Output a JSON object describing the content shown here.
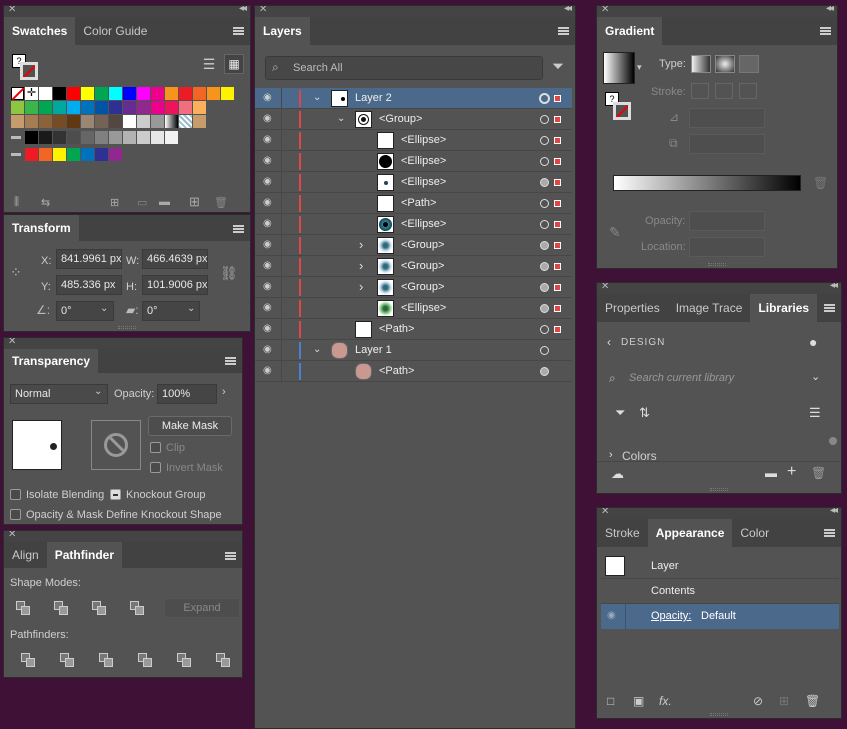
{
  "swatches": {
    "tabs": [
      "Swatches",
      "Color Guide"
    ],
    "colors_row1": [
      "#ffffff",
      "#000000",
      "#ff0000",
      "#ffff00",
      "#00a651",
      "#00ffff",
      "#0000ff",
      "#ff00ff",
      "#ec008c",
      "#f7941d",
      "#ed1c24",
      "#f26522",
      "#f7941d",
      "#fff200"
    ],
    "colors_row2": [
      "#8dc63f",
      "#39b54a",
      "#00a651",
      "#00a99d",
      "#00aeef",
      "#0072bc",
      "#0054a6",
      "#2e3192",
      "#662d91",
      "#92278f",
      "#ec008c",
      "#ed145b",
      "#f26d7d",
      "#fbaf5d"
    ],
    "colors_row3": [
      "#c69c6d",
      "#a67c52",
      "#8c6239",
      "#754c24",
      "#603913",
      "#998675",
      "#736357",
      "#534741",
      "#ffffff",
      "#cccccc",
      "#999999",
      "#f7941d",
      "#7da7d9",
      "#c69c6d"
    ],
    "grays": [
      "#000000",
      "#1a1a1a",
      "#333333",
      "#4d4d4d",
      "#666666",
      "#808080",
      "#999999",
      "#b3b3b3",
      "#cccccc",
      "#e6e6e6",
      "#f2f2f2"
    ],
    "brights": [
      "#ed1c24",
      "#f26522",
      "#fff200",
      "#00a651",
      "#0072bc",
      "#2e3192",
      "#92278f"
    ]
  },
  "transform": {
    "title": "Transform",
    "x_label": "X:",
    "x_value": "841.9961 px",
    "y_label": "Y:",
    "y_value": "485.336 px",
    "w_label": "W:",
    "w_value": "466.4639 px",
    "h_label": "H:",
    "h_value": "101.9006 px",
    "angle_value": "0°",
    "shear_value": "0°"
  },
  "transparency": {
    "title": "Transparency",
    "blend_mode": "Normal",
    "opacity_label": "Opacity:",
    "opacity_value": "100%",
    "make_mask": "Make Mask",
    "clip": "Clip",
    "invert_mask": "Invert Mask",
    "isolate_blending": "Isolate Blending",
    "knockout_group": "Knockout Group",
    "opacity_mask_define": "Opacity & Mask Define Knockout Shape"
  },
  "pathfinder": {
    "tabs": [
      "Align",
      "Pathfinder"
    ],
    "shape_modes": "Shape Modes:",
    "expand": "Expand",
    "pathfinders": "Pathfinders:"
  },
  "layers": {
    "title": "Layers",
    "search_placeholder": "Search All",
    "rows": [
      {
        "name": "Layer 2",
        "indent": 0,
        "chevron": "expanded",
        "thumb": "dot",
        "color": "#e04646",
        "selected": true
      },
      {
        "name": "<Group>",
        "indent": 1,
        "chevron": "expanded",
        "thumb": "target",
        "color": "#e04646",
        "selected": false
      },
      {
        "name": "<Ellipse>",
        "indent": 2,
        "chevron": "",
        "thumb": "white",
        "color": "#e04646",
        "selected": false
      },
      {
        "name": "<Ellipse>",
        "indent": 2,
        "chevron": "",
        "thumb": "black",
        "color": "#e04646",
        "selected": false
      },
      {
        "name": "<Ellipse>",
        "indent": 2,
        "chevron": "",
        "thumb": "tiny",
        "color": "#e04646",
        "selected": false
      },
      {
        "name": "<Path>",
        "indent": 2,
        "chevron": "",
        "thumb": "white",
        "color": "#e04646",
        "selected": false
      },
      {
        "name": "<Ellipse>",
        "indent": 2,
        "chevron": "",
        "thumb": "eye",
        "color": "#e04646",
        "selected": false
      },
      {
        "name": "<Group>",
        "indent": 2,
        "chevron": "collapsed",
        "thumb": "pattern",
        "color": "#e04646",
        "selected": false
      },
      {
        "name": "<Group>",
        "indent": 2,
        "chevron": "collapsed",
        "thumb": "pattern",
        "color": "#e04646",
        "selected": false
      },
      {
        "name": "<Group>",
        "indent": 2,
        "chevron": "collapsed",
        "thumb": "pattern",
        "color": "#e04646",
        "selected": false
      },
      {
        "name": "<Ellipse>",
        "indent": 2,
        "chevron": "",
        "thumb": "green",
        "color": "#e04646",
        "selected": false
      },
      {
        "name": "<Path>",
        "indent": 1,
        "chevron": "",
        "thumb": "white",
        "color": "#e04646",
        "selected": false
      },
      {
        "name": "Layer 1",
        "indent": 0,
        "chevron": "expanded",
        "thumb": "pink",
        "color": "#4a7fd4",
        "selected": false
      },
      {
        "name": "<Path>",
        "indent": 1,
        "chevron": "",
        "thumb": "pink",
        "color": "#4a7fd4",
        "selected": false
      }
    ]
  },
  "gradient": {
    "title": "Gradient",
    "type_label": "Type:",
    "stroke_label": "Stroke:",
    "opacity_label": "Opacity:",
    "location_label": "Location:"
  },
  "libraries": {
    "tabs": [
      "Properties",
      "Image Trace",
      "Libraries"
    ],
    "back_label": "DESIGN",
    "search_placeholder": "Search current library",
    "colors_label": "Colors"
  },
  "appearance": {
    "tabs": [
      "Stroke",
      "Appearance",
      "Color"
    ],
    "layer_label": "Layer",
    "contents_label": "Contents",
    "opacity_label": "Opacity:",
    "opacity_value": "Default"
  }
}
